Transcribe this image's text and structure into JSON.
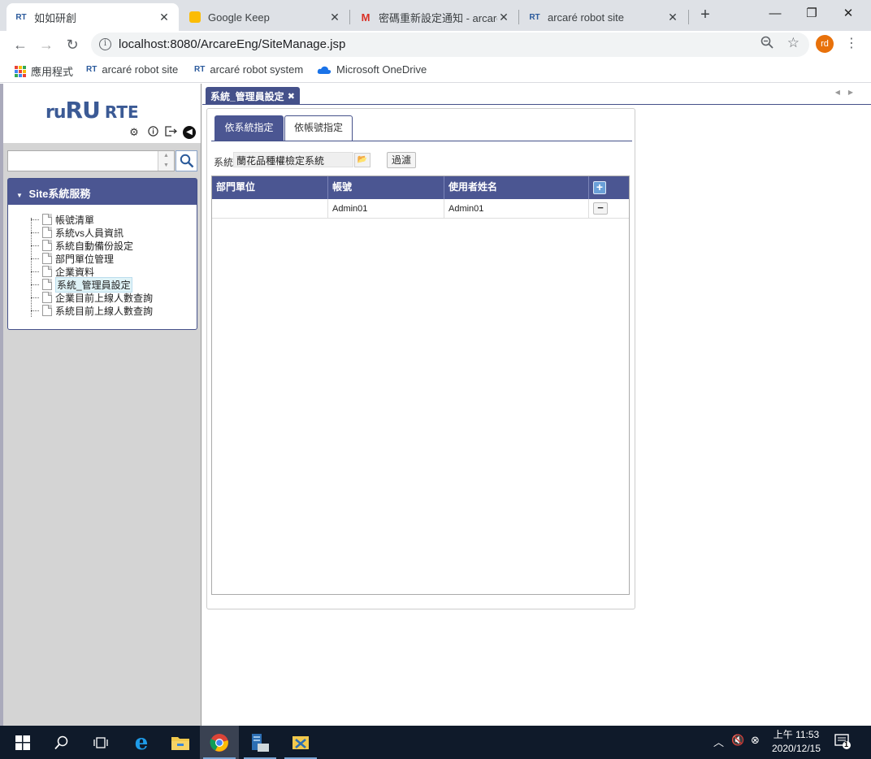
{
  "browser": {
    "tabs": [
      {
        "favicon": "RT",
        "title": "如如研創",
        "active": true
      },
      {
        "favicon": "keep-icon",
        "title": "Google Keep",
        "active": false
      },
      {
        "favicon": "gmail-icon",
        "title": "密碼重新設定通知 - arcare",
        "active": false
      },
      {
        "favicon": "RT",
        "title": "arcaré robot site",
        "active": false
      }
    ],
    "url": "localhost:8080/ArcareEng/SiteManage.jsp",
    "profile_initials": "rd",
    "bookmarks": [
      {
        "icon": "apps-grid-icon",
        "label": "應用程式"
      },
      {
        "icon": "RT",
        "label": "arcaré robot site"
      },
      {
        "icon": "RT",
        "label": "arcaré robot system"
      },
      {
        "icon": "onedrive-icon",
        "label": "Microsoft OneDrive"
      }
    ]
  },
  "sidebar": {
    "logo": {
      "part1": "ru",
      "part2": "RU",
      "part3": "RTE"
    },
    "search": {
      "value": ""
    },
    "panel_title": "Site系統服務",
    "tree_items": [
      {
        "label": "帳號清單",
        "selected": false
      },
      {
        "label": "系統vs人員資訊",
        "selected": false
      },
      {
        "label": "系統自動備份設定",
        "selected": false
      },
      {
        "label": "部門單位管理",
        "selected": false
      },
      {
        "label": "企業資料",
        "selected": false
      },
      {
        "label": "系統_管理員設定",
        "selected": true
      },
      {
        "label": "企業目前上線人數查詢",
        "selected": false
      },
      {
        "label": "系統目前上線人數查詢",
        "selected": false
      }
    ]
  },
  "content": {
    "tab_title": "系統_管理員設定",
    "subtabs": [
      {
        "label": "依系統指定",
        "active": true
      },
      {
        "label": "依帳號指定",
        "active": false
      }
    ],
    "system_label": "系統",
    "system_value": "蘭花品種權檢定系統",
    "filter_label": "過濾",
    "grid": {
      "columns": [
        "部門單位",
        "帳號",
        "使用者姓名"
      ],
      "rows": [
        {
          "dept": "",
          "account": "Admin01",
          "name": "Admin01"
        }
      ]
    }
  },
  "taskbar": {
    "time": "上午 11:53",
    "date": "2020/12/15",
    "notification_count": "1"
  },
  "colors": {
    "brand": "#4b5692",
    "chrome_tabstrip": "#dee1e6",
    "taskbar": "#0f1a2a",
    "profile": "#e8710a"
  }
}
